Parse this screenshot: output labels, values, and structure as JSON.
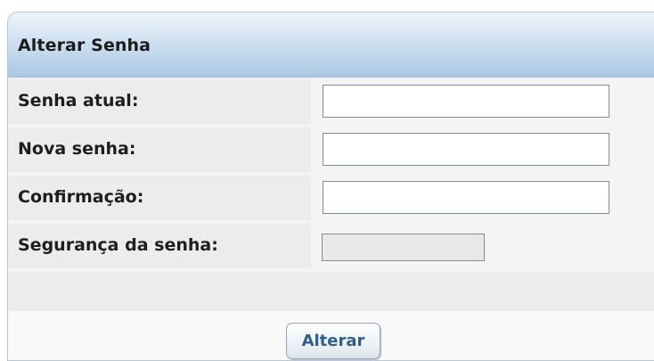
{
  "panel": {
    "title": "Alterar Senha"
  },
  "form": {
    "fields": [
      {
        "label": "Senha atual:",
        "value": "",
        "placeholder": ""
      },
      {
        "label": "Nova senha:",
        "value": "",
        "placeholder": ""
      },
      {
        "label": "Confirmação:",
        "value": "",
        "placeholder": ""
      }
    ],
    "strength": {
      "label": "Segurança da senha:",
      "level": 0
    }
  },
  "actions": {
    "submit_label": "Alterar"
  },
  "colors": {
    "header_gradient_top": "#eef4fb",
    "header_gradient_bottom": "#aac7e2",
    "button_text": "#2f5f8c",
    "label_cell_bg": "#ececec"
  }
}
